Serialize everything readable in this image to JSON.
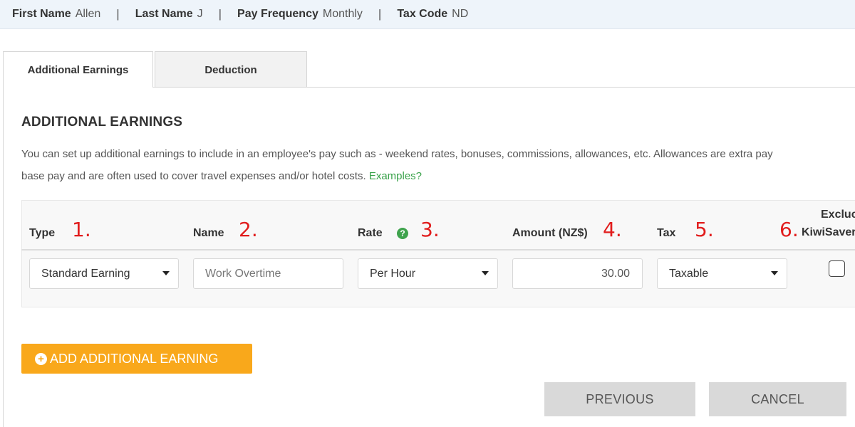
{
  "employee": {
    "first_name_label": "First Name",
    "first_name": "Allen",
    "last_name_label": "Last Name",
    "last_name": "J",
    "pay_frequency_label": "Pay Frequency",
    "pay_frequency": "Monthly",
    "tax_code_label": "Tax Code",
    "tax_code": "ND",
    "separator": "|"
  },
  "tabs": [
    {
      "label": "Additional Earnings",
      "active": true
    },
    {
      "label": "Deduction",
      "active": false
    }
  ],
  "section": {
    "title": "ADDITIONAL EARNINGS",
    "description_line1": "You can set up additional earnings to include in an employee's pay such as - weekend rates, bonuses, commissions, allowances, etc. Allowances are extra pay",
    "description_line2": "base pay and are often used to cover travel expenses and/or hotel costs.",
    "examples_link": "Examples?"
  },
  "columns": {
    "type": "Type",
    "name": "Name",
    "rate": "Rate",
    "amount": "Amount (NZ$)",
    "tax": "Tax",
    "exclude_line1": "Excluc",
    "exclude_line2": "KiwiSaver"
  },
  "annotations": [
    "1.",
    "2.",
    "3.",
    "4.",
    "5.",
    "6."
  ],
  "row": {
    "type": "Standard Earning",
    "name": "Work Overtime",
    "rate": "Per Hour",
    "amount": "30.00",
    "tax": "Taxable",
    "exclude_kiwisaver": false
  },
  "help_icon_glyph": "?",
  "buttons": {
    "add": "ADD ADDITIONAL EARNING",
    "add_icon_glyph": "+",
    "previous": "PREVIOUS",
    "cancel": "CANCEL"
  },
  "colors": {
    "accent_orange": "#f9a81b",
    "annotation_red": "#e11d1d",
    "link_green": "#39a24a",
    "button_grey": "#d9d9d9"
  }
}
